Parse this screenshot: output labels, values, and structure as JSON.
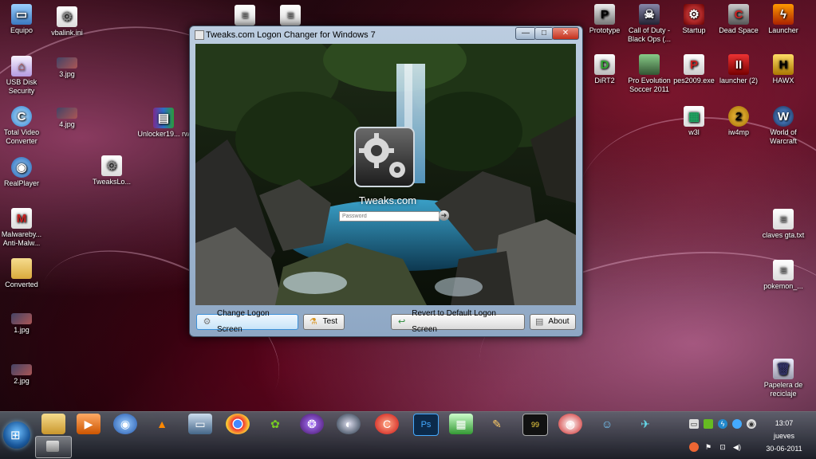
{
  "desktop_left": [
    {
      "label": "Equipo"
    },
    {
      "label": "USB Disk Security"
    },
    {
      "label": "Total Video Converter"
    },
    {
      "label": "RealPlayer"
    },
    {
      "label": "Malwareby... Anti-Malw..."
    },
    {
      "label": "Converted"
    },
    {
      "label": "1.jpg"
    },
    {
      "label": "2.jpg"
    }
  ],
  "desktop_mid": [
    {
      "label": "vbalink.ini"
    },
    {
      "label": "3.jpg"
    },
    {
      "label": "4.jpg"
    },
    {
      "label": "TweaksLo..."
    },
    {
      "label": "Unlocker19... rw"
    }
  ],
  "desktop_right": [
    {
      "label": "Prototype"
    },
    {
      "label": "Call of Duty - Black Ops (..."
    },
    {
      "label": "Startup"
    },
    {
      "label": "Dead Space"
    },
    {
      "label": "Launcher"
    },
    {
      "label": "DiRT2"
    },
    {
      "label": "Pro Evolution Soccer 2011"
    },
    {
      "label": "pes2009.exe"
    },
    {
      "label": "launcher (2)"
    },
    {
      "label": "HAWX"
    },
    {
      "label": "w3l"
    },
    {
      "label": "iw4mp"
    },
    {
      "label": "World of Warcraft"
    },
    {
      "label": "claves gta.txt"
    },
    {
      "label": "pokemon_..."
    },
    {
      "label": "Papelera de reciclaje"
    }
  ],
  "window": {
    "title": "Tweaks.com Logon Changer for Windows 7",
    "controls": {
      "minimize": "—",
      "maximize": "□",
      "close": "✕"
    },
    "preview": {
      "brand": "Tweaks.com",
      "password_placeholder": "Password"
    },
    "buttons": {
      "change": "Change Logon Screen",
      "test": "Test",
      "revert": "Revert to Default Logon Screen",
      "about": "About"
    }
  },
  "taskbar": {
    "start": "⊞",
    "clock": {
      "time": "13:07",
      "day": "jueves",
      "date": "30-06-2011"
    }
  },
  "colors": {
    "accent": "#3c90d8",
    "taskbar": "#1c222a",
    "close": "#c4301c"
  }
}
